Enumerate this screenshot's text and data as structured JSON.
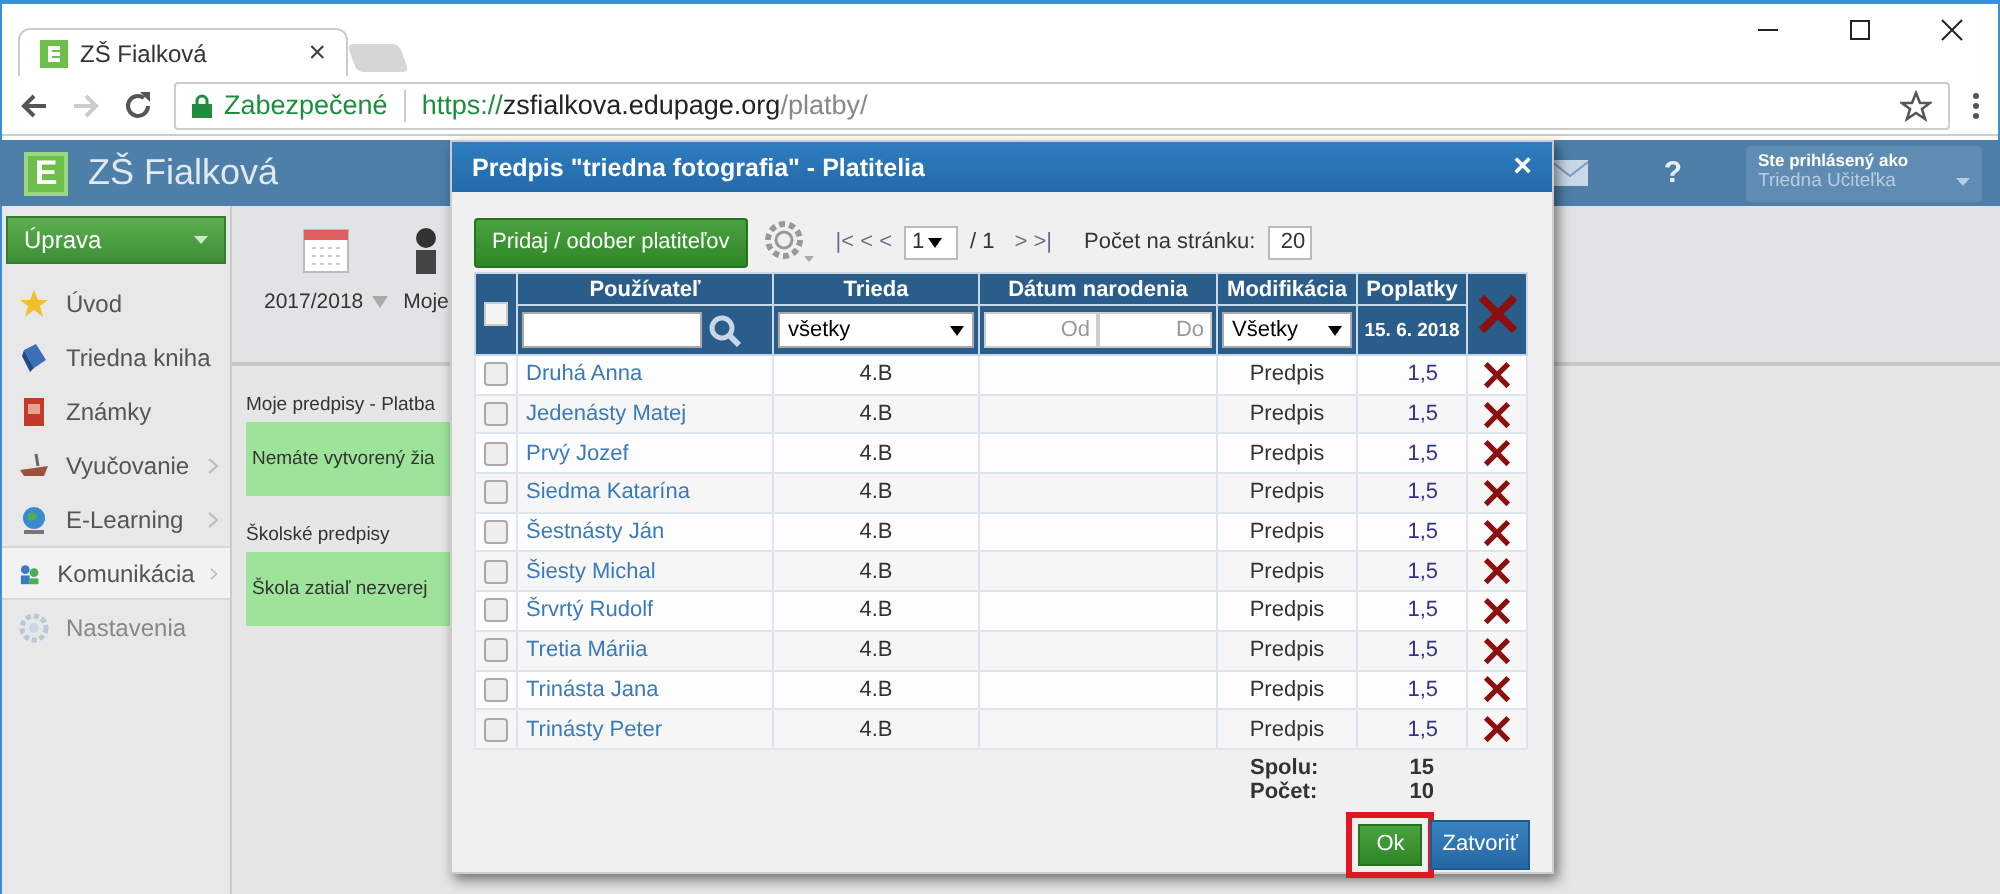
{
  "browser": {
    "tab": {
      "title": "ZŠ Fialková",
      "close": "×"
    },
    "address": {
      "secure_label": "Zabezpečené",
      "url_parts": [
        "https://",
        "zsfialkova.edupage.org",
        "/platby/"
      ]
    }
  },
  "header": {
    "logo_letter": "E",
    "school": "ZŠ Fialková",
    "help": "?",
    "user_caption": "Ste prihlásený ako",
    "user_name": "Triedna Učiteľka"
  },
  "sidebar": {
    "edit_button": "Úprava",
    "items": [
      {
        "label": "Úvod",
        "submenu": false,
        "selected": false
      },
      {
        "label": "Triedna kniha",
        "submenu": false,
        "selected": false
      },
      {
        "label": "Známky",
        "submenu": false,
        "selected": false
      },
      {
        "label": "Vyučovanie",
        "submenu": true,
        "selected": false
      },
      {
        "label": "E-Learning",
        "submenu": true,
        "selected": false
      },
      {
        "label": "Komunikácia",
        "submenu": true,
        "selected": true
      },
      {
        "label": "Nastavenia",
        "submenu": false,
        "selected": false
      }
    ]
  },
  "toolbar": {
    "year": "2017/2018",
    "next": "Moje"
  },
  "content": [
    {
      "heading": "Moje predpisy - Platba",
      "message": "Nemáte vytvorený žia"
    },
    {
      "heading": "Školské predpisy",
      "message": "Škola zatiaľ nezverej"
    }
  ],
  "dialog": {
    "title": "Predpis \"triedna fotografia\" - Platitelia",
    "close": "×",
    "add_button": "Pridaj / odober platiteľov",
    "pager": {
      "prev": "|< < <",
      "page": "1",
      "total": "/ 1",
      "next": "> >|",
      "per_page_label": "Počet na stránku:",
      "per_page": "20"
    },
    "table": {
      "select_all_checked": false,
      "columns": [
        "Používateľ",
        "Trieda",
        "Dátum narodenia",
        "Modifikácia",
        "Poplatky"
      ],
      "filters": {
        "class": "všetky",
        "date_from_placeholder": "Od",
        "date_to_placeholder": "Do",
        "modification": "Všetky",
        "fee_date": "15. 6. 2018"
      },
      "rows": [
        {
          "checked": false,
          "user": "Druhá Anna",
          "class": "4.B",
          "modification": "Predpis",
          "fee": "1,5"
        },
        {
          "checked": false,
          "user": "Jedenásty Matej",
          "class": "4.B",
          "modification": "Predpis",
          "fee": "1,5"
        },
        {
          "checked": false,
          "user": "Prvý Jozef",
          "class": "4.B",
          "modification": "Predpis",
          "fee": "1,5"
        },
        {
          "checked": false,
          "user": "Siedma Katarína",
          "class": "4.B",
          "modification": "Predpis",
          "fee": "1,5"
        },
        {
          "checked": false,
          "user": "Šestnásty Ján",
          "class": "4.B",
          "modification": "Predpis",
          "fee": "1,5"
        },
        {
          "checked": false,
          "user": "Šiesty Michal",
          "class": "4.B",
          "modification": "Predpis",
          "fee": "1,5"
        },
        {
          "checked": false,
          "user": "Šrvrtý Rudolf",
          "class": "4.B",
          "modification": "Predpis",
          "fee": "1,5"
        },
        {
          "checked": false,
          "user": "Tretia Máriia",
          "class": "4.B",
          "modification": "Predpis",
          "fee": "1,5"
        },
        {
          "checked": false,
          "user": "Trinásta Jana",
          "class": "4.B",
          "modification": "Predpis",
          "fee": "1,5"
        },
        {
          "checked": false,
          "user": "Trinásty Peter",
          "class": "4.B",
          "modification": "Predpis",
          "fee": "1,5"
        }
      ]
    },
    "summary": [
      {
        "label": "Spolu:",
        "value": "15"
      },
      {
        "label": "Počet:",
        "value": "10"
      }
    ],
    "ok_button": "Ok",
    "ok_highlighted": true,
    "close_button": "Zatvoriť"
  }
}
